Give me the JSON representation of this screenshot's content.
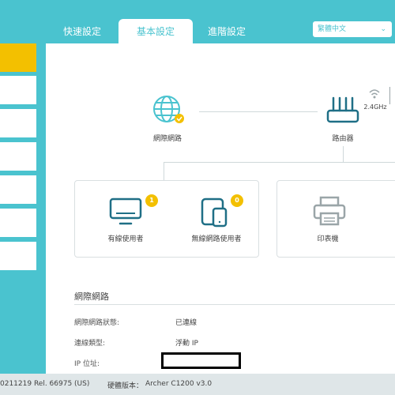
{
  "tabs": [
    {
      "label": "快速設定"
    },
    {
      "label": "基本設定"
    },
    {
      "label": "進階設定"
    }
  ],
  "language": {
    "selected": "繁體中文"
  },
  "topology": {
    "internet_label": "網際網路",
    "router_label": "路由器",
    "wifi_band": "2.4GHz",
    "wired_clients": {
      "label": "有線使用者",
      "count": "1"
    },
    "wireless_clients": {
      "label": "無線網路使用者",
      "count": "0"
    },
    "printer_label": "印表機"
  },
  "internet_info": {
    "title": "網際網路",
    "rows": [
      {
        "label": "網際網路狀態:",
        "value": "已連線"
      },
      {
        "label": "連線類型:",
        "value": "浮動 IP"
      },
      {
        "label": "IP 位址:",
        "value": ""
      }
    ]
  },
  "footer": {
    "firmware": "0211219 Rel. 66975 (US)",
    "hardware_label": "硬體版本：",
    "hardware_value": "Archer C1200 v3.0"
  },
  "colors": {
    "accent": "#4ac3cf",
    "highlight": "#f3c000",
    "icon": "#1f6f86"
  }
}
